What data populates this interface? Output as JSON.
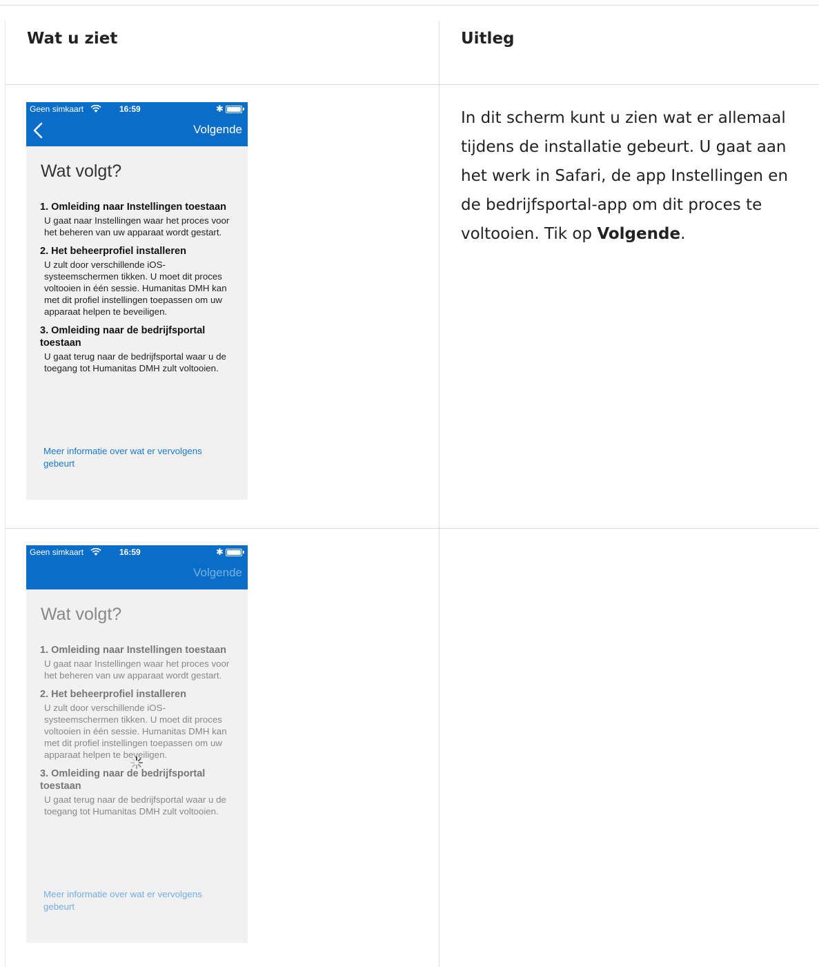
{
  "table": {
    "col_left_header": "Wat u ziet",
    "col_right_header": "Uitleg"
  },
  "explanation": {
    "text_before": "In dit scherm kunt u zien wat er allemaal tijdens de installatie gebeurt. U gaat aan het werk in Safari, de app Instellingen en de bedrijfsportal-app om dit proces te voltooien. Tik op ",
    "bold": "Volgende",
    "text_after": "."
  },
  "phone": {
    "carrier": "Geen simkaart",
    "time": "16:59",
    "next_label": "Volgende",
    "title": "Wat volgt?",
    "steps": [
      {
        "heading": "1. Omleiding naar Instellingen toestaan",
        "body": "U gaat naar Instellingen waar het proces voor het beheren van uw apparaat wordt gestart."
      },
      {
        "heading": "2. Het beheerprofiel installeren",
        "body": "U zult door verschillende iOS-systeemschermen tikken. U moet dit proces voltooien in één sessie. Humanitas DMH kan met dit profiel instellingen toepassen om uw apparaat helpen te beveiligen."
      },
      {
        "heading": "3. Omleiding naar de bedrijfsportal toestaan",
        "body": "U gaat terug naar de bedrijfsportal waar u de toegang tot Humanitas DMH zult voltooien."
      }
    ],
    "more_link": "Meer informatie over wat er vervolgens gebeurt"
  },
  "colors": {
    "nav_bar": "#0a6ec8",
    "link": "#1778d2",
    "screen_bg": "#f1f1f1"
  }
}
